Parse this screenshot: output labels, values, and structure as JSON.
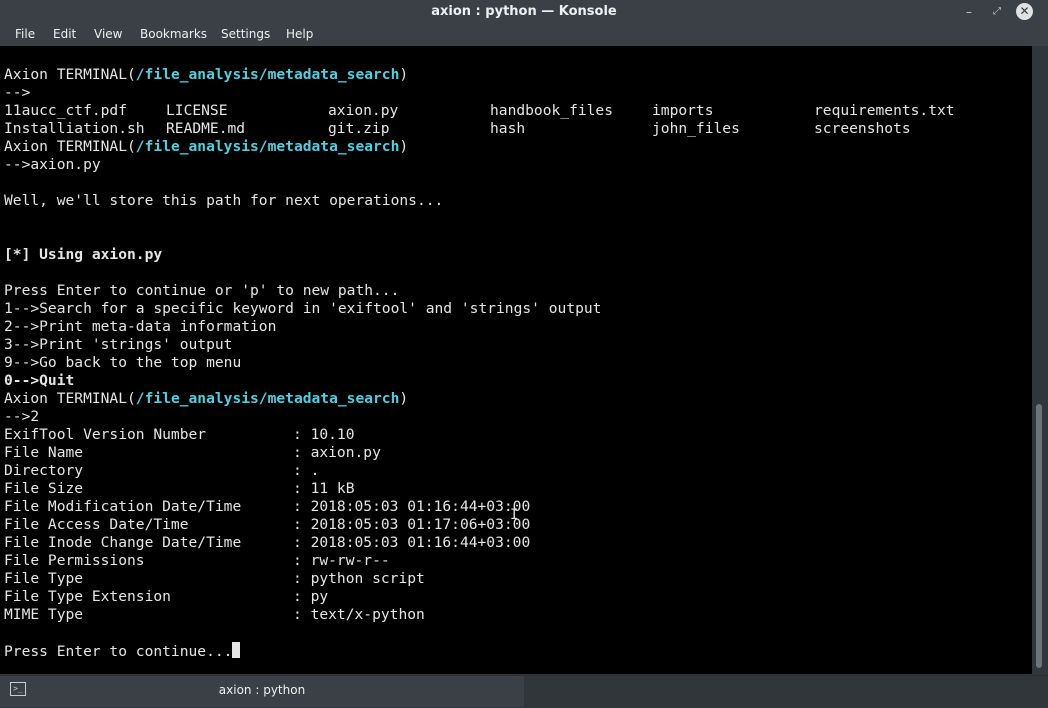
{
  "window": {
    "title": "axion : python — Konsole",
    "controls": {
      "minimize": "–",
      "maximize": "⤢",
      "close": "✕"
    }
  },
  "menu": [
    "File",
    "Edit",
    "View",
    "Bookmarks",
    "Settings",
    "Help"
  ],
  "terminal": {
    "prompt_prefix": "Axion TERMINAL(",
    "prompt_path": "/file_analysis/metadata_search",
    "prompt_suffix": ")",
    "arrow": "-->",
    "files": [
      [
        "11aucc_ctf.pdf",
        "LICENSE",
        "axion.py",
        "handbook_files",
        "imports",
        "requirements.txt"
      ],
      [
        "Installiation.sh",
        "README.md",
        "git.zip",
        "hash",
        "john_files",
        "screenshots"
      ]
    ],
    "cmd_file": "axion.py",
    "store_msg": "Well, we'll store this path for next operations...",
    "using_msg": "[*] Using axion.py",
    "press_new_path": "Press Enter to continue or 'p' to new path...",
    "options": [
      "1-->Search for a specific keyword in 'exiftool' and 'strings' output",
      "2-->Print meta-data information",
      "3-->Print 'strings' output",
      "9-->Go back to the top menu",
      "0-->Quit"
    ],
    "choice": "2",
    "metadata": [
      {
        "key": "ExifTool Version Number",
        "value": "10.10"
      },
      {
        "key": "File Name",
        "value": "axion.py"
      },
      {
        "key": "Directory",
        "value": "."
      },
      {
        "key": "File Size",
        "value": "11 kB"
      },
      {
        "key": "File Modification Date/Time",
        "value": "2018:05:03 01:16:44+03:00"
      },
      {
        "key": "File Access Date/Time",
        "value": "2018:05:03 01:17:06+03:00"
      },
      {
        "key": "File Inode Change Date/Time",
        "value": "2018:05:03 01:16:44+03:00"
      },
      {
        "key": "File Permissions",
        "value": "rw-rw-r--"
      },
      {
        "key": "File Type",
        "value": "python script"
      },
      {
        "key": "File Type Extension",
        "value": "py"
      },
      {
        "key": "MIME Type",
        "value": "text/x-python"
      }
    ],
    "press_continue": "Press Enter to continue..."
  },
  "taskbar": {
    "tab_label": "axion : python",
    "icon": "terminal-icon"
  },
  "colors": {
    "background": "#000000",
    "text": "#e5e5e5",
    "path": "#4dd0e1",
    "using": "#6be35b",
    "metadata": "#e08a48",
    "quit": "#ff4d4d"
  }
}
